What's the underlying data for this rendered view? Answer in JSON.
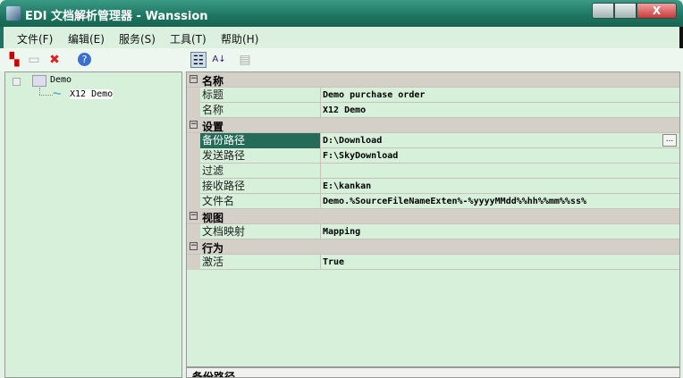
{
  "window": {
    "title": "EDI 文档解析管理器 - Wanssion",
    "close_glyph": "X"
  },
  "menu": [
    "文件(F)",
    "编辑(E)",
    "服务(S)",
    "工具(T)",
    "帮助(H)"
  ],
  "toolbar": {
    "left": [
      "add-node-icon",
      "folder-icon",
      "delete-icon",
      "help-icon"
    ],
    "right": [
      "categorized-icon",
      "alphabetical-icon",
      "property-pages-icon"
    ],
    "az": "A↓"
  },
  "tree": {
    "root": "Demo",
    "child": "X12 Demo"
  },
  "grid": {
    "categories": [
      {
        "name": "名称",
        "props": [
          {
            "label": "标题",
            "value": "Demo purchase order"
          },
          {
            "label": "名称",
            "value": "X12 Demo"
          }
        ]
      },
      {
        "name": "设置",
        "props": [
          {
            "label": "备份路径",
            "value": "D:\\Download"
          },
          {
            "label": "发送路径",
            "value": "F:\\SkyDownload"
          },
          {
            "label": "过滤",
            "value": ""
          },
          {
            "label": "接收路径",
            "value": "E:\\kankan"
          },
          {
            "label": "文件名",
            "value": "Demo.%SourceFileNameExten%-%yyyyMMdd%%hh%%mm%%ss%"
          }
        ]
      },
      {
        "name": "视图",
        "props": [
          {
            "label": "文档映射",
            "value": "Mapping"
          }
        ]
      },
      {
        "name": "行为",
        "props": [
          {
            "label": "激活",
            "value": "True"
          }
        ]
      }
    ],
    "ellipsis": "..."
  },
  "description": {
    "title": "备份路径"
  }
}
